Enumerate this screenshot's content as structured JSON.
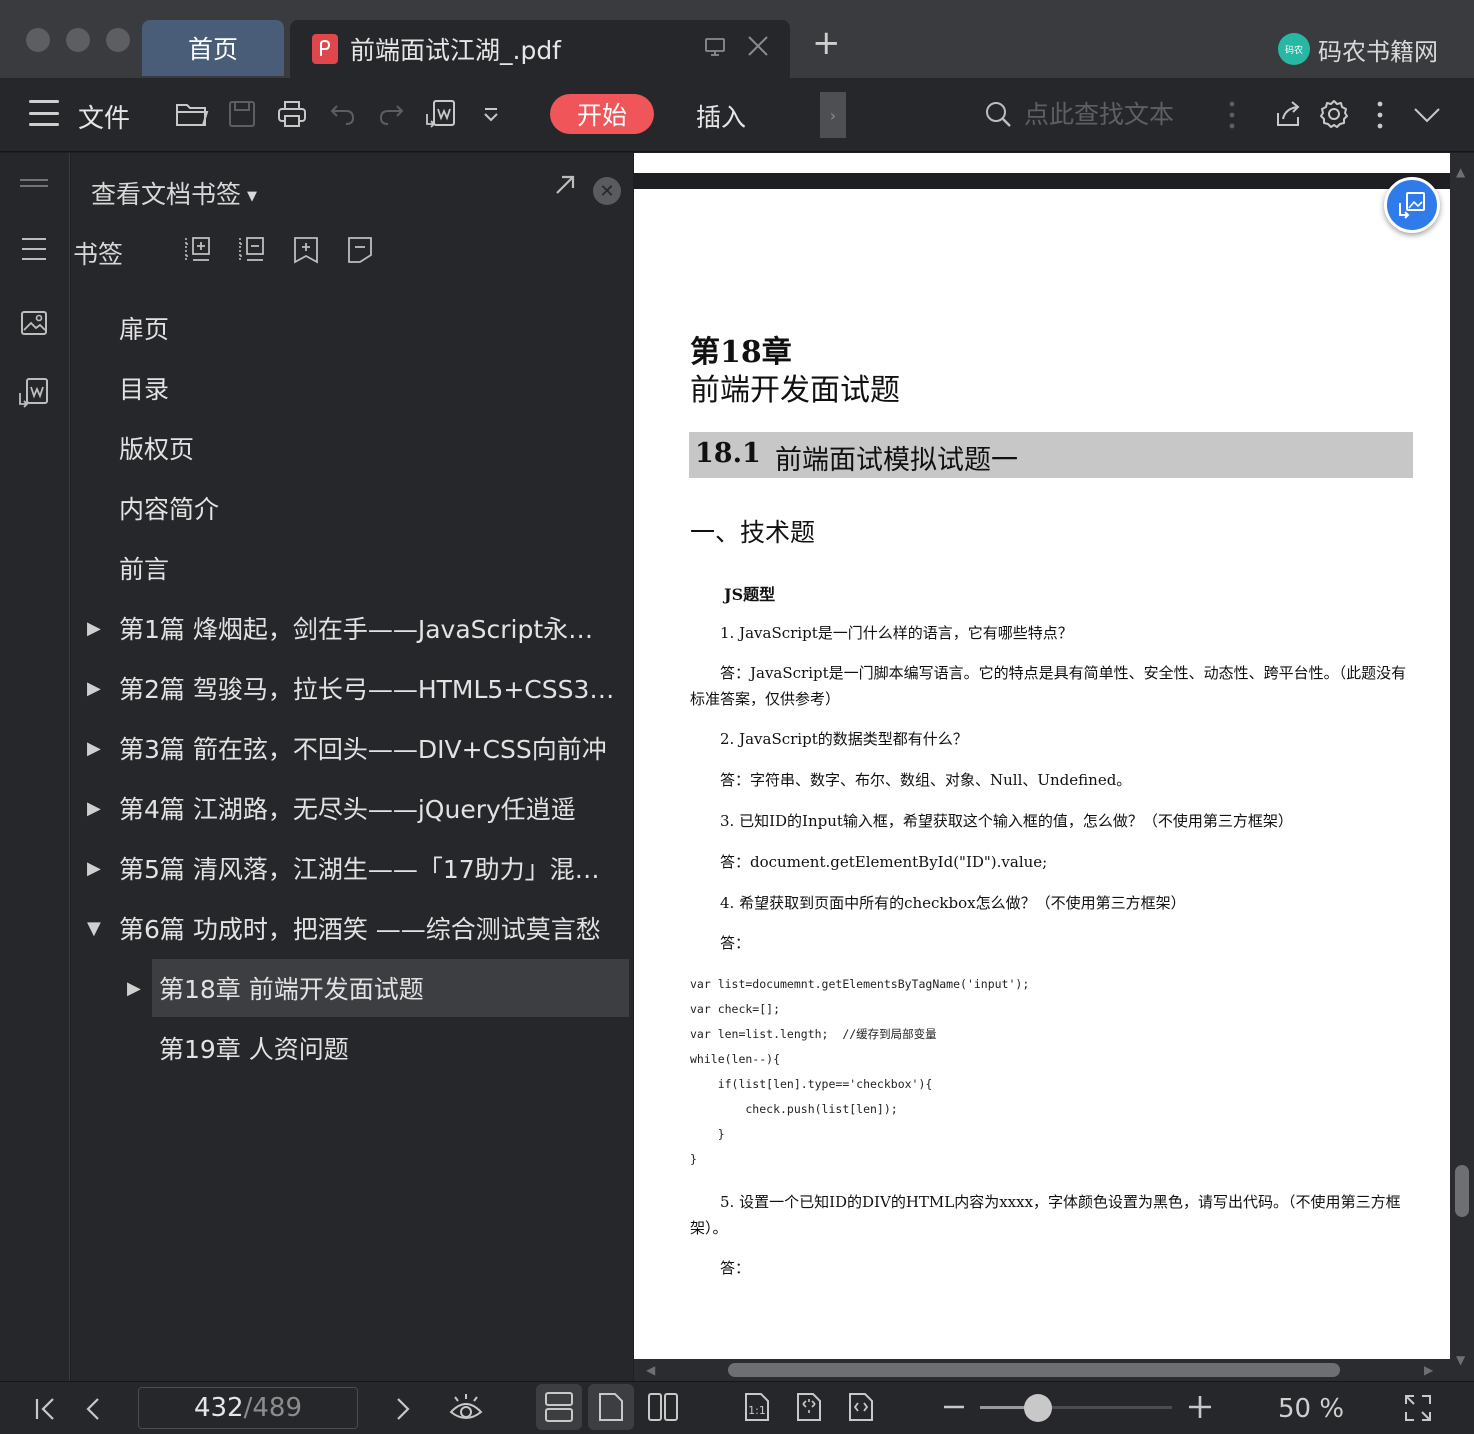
{
  "titlebar": {
    "tabs": [
      {
        "label": "首页"
      },
      {
        "label": "前端面试江湖_.pdf"
      }
    ],
    "new_tab": "+",
    "site_logo": "码农",
    "site_name": "码农书籍网"
  },
  "toolbar": {
    "file_label": "文件",
    "start_label": "开始",
    "insert_label": "插入",
    "search_placeholder": "点此查找文本",
    "icons": [
      "menu-icon",
      "open-folder-icon",
      "save-icon",
      "print-icon",
      "undo-icon",
      "redo-icon",
      "convert-icon",
      "dropdown-icon",
      "search-icon",
      "more-vertical-icon",
      "share-icon",
      "settings-icon",
      "more-vertical-icon",
      "chevron-down-icon"
    ]
  },
  "sidebar": {
    "panel_title": "查看文档书签",
    "bookmark_label": "书签",
    "bookmarks": [
      {
        "label": "扉页",
        "level": 0,
        "expandable": false
      },
      {
        "label": "目录",
        "level": 0,
        "expandable": false
      },
      {
        "label": "版权页",
        "level": 0,
        "expandable": false
      },
      {
        "label": "内容简介",
        "level": 0,
        "expandable": false
      },
      {
        "label": "前言",
        "level": 0,
        "expandable": false
      },
      {
        "label": "第1篇 烽烟起，剑在手——JavaScript永…",
        "level": 0,
        "expandable": true
      },
      {
        "label": "第2篇 驾骏马，拉长弓——HTML5+CSS3…",
        "level": 0,
        "expandable": true
      },
      {
        "label": "第3篇 箭在弦，不回头——DIV+CSS向前冲",
        "level": 0,
        "expandable": true
      },
      {
        "label": "第4篇 江湖路，无尽头——jQuery任逍遥",
        "level": 0,
        "expandable": true
      },
      {
        "label": "第5篇 清风落，江湖生——「17助力」混…",
        "level": 0,
        "expandable": true
      },
      {
        "label": "第6篇 功成时，把酒笑 ——综合测试莫言愁",
        "level": 0,
        "expandable": true,
        "expanded": true
      },
      {
        "label": "第18章 前端开发面试题",
        "level": 1,
        "expandable": true,
        "selected": true
      },
      {
        "label": "第19章 人资问题",
        "level": 1,
        "expandable": false
      }
    ]
  },
  "document": {
    "chapter_no": "第18章",
    "chapter_title": "前端开发面试题",
    "section_no": "18.1",
    "section_title": "前端面试模拟试题一",
    "part_heading": "一、技术题",
    "js_type": "JS题型",
    "paragraphs": [
      "1. JavaScript是一门什么样的语言，它有哪些特点？",
      "答：JavaScript是一门脚本编写语言。它的特点是具有简单性、安全性、动态性、跨平台性。（此题没有标准答案，仅供参考）",
      "2. JavaScript的数据类型都有什么？",
      "答：字符串、数字、布尔、数组、对象、Null、Undefined。",
      "3. 已知ID的Input输入框，希望获取这个输入框的值，怎么做？（不使用第三方框架）",
      "答：document.getElementById(\"ID\").value;",
      "4. 希望获取到页面中所有的checkbox怎么做？（不使用第三方框架）",
      "答："
    ],
    "code_lines": [
      "var list=documemnt.getElementsByTagName('input');",
      "var check=[];",
      "var len=list.length;  //缓存到局部变量",
      "while(len--){",
      "    if(list[len].type=='checkbox'){",
      "        check.push(list[len]);",
      "    }",
      "}"
    ],
    "after_code": [
      "5. 设置一个已知ID的DIV的HTML内容为xxxx，字体颜色设置为黑色，请写出代码。（不使用第三方框架）。",
      "答："
    ]
  },
  "statusbar": {
    "current_page": "432",
    "separator": "/",
    "total_pages": "489",
    "zoom_level": "50 %",
    "zoom_fraction": 0.3
  },
  "colors": {
    "accent_red": "#f0555a",
    "accent_blue": "#2f7bea",
    "selected_row": "#3d3e42",
    "section_bar": "#c7c7c7"
  }
}
